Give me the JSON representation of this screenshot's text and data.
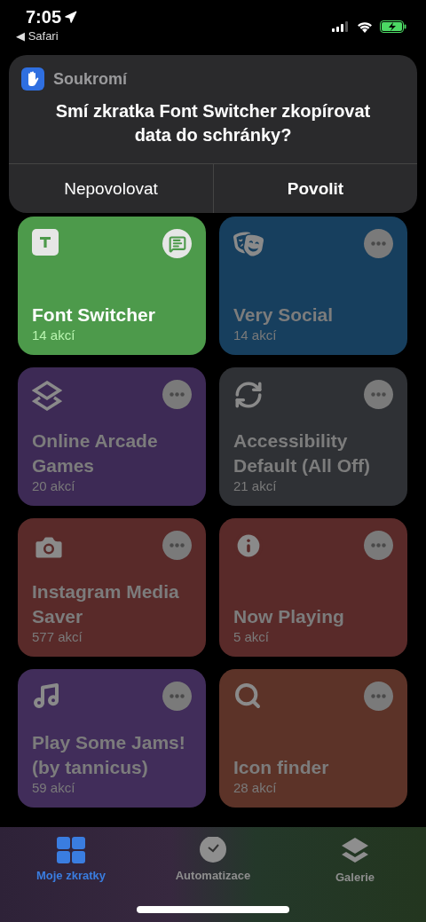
{
  "status_bar": {
    "time": "7:05",
    "back_arrow": "◀",
    "back_app": "Safari"
  },
  "alert": {
    "app": "Soukromí",
    "message": "Smí zkratka Font Switcher zkopírovat data do schránky?",
    "buttons": [
      {
        "label": "Nepovolovat",
        "kind": "cancel"
      },
      {
        "label": "Povolit",
        "kind": "default"
      }
    ]
  },
  "shortcuts": [
    {
      "title": "Font Switcher",
      "count": "14 akcí",
      "color": "#4d9a4b",
      "dimmed": false
    },
    {
      "title": "Very Social",
      "count": "14 akcí",
      "color": "#173f5e",
      "dimmed": true
    },
    {
      "title": "Online Arcade Games",
      "count": "20 akcí",
      "color": "#3d2a55",
      "dimmed": true
    },
    {
      "title": "Accessibility Default (All Off)",
      "count": "21 akcí",
      "color": "#2f3135",
      "dimmed": true
    },
    {
      "title": "Instagram Media Saver",
      "count": "577 akcí",
      "color": "#592a29",
      "dimmed": true
    },
    {
      "title": "Now Playing",
      "count": "5 akcí",
      "color": "#592a29",
      "dimmed": true
    },
    {
      "title": "Play Some Jams! (by tannicus)",
      "count": "59 akcí",
      "color": "#412d5a",
      "dimmed": true
    },
    {
      "title": "Icon finder",
      "count": "28 akcí",
      "color": "#5c3328",
      "dimmed": true
    }
  ],
  "tabs": [
    {
      "label": "Moje zkratky",
      "selected": true
    },
    {
      "label": "Automatizace",
      "selected": false
    },
    {
      "label": "Galerie",
      "selected": false
    }
  ]
}
